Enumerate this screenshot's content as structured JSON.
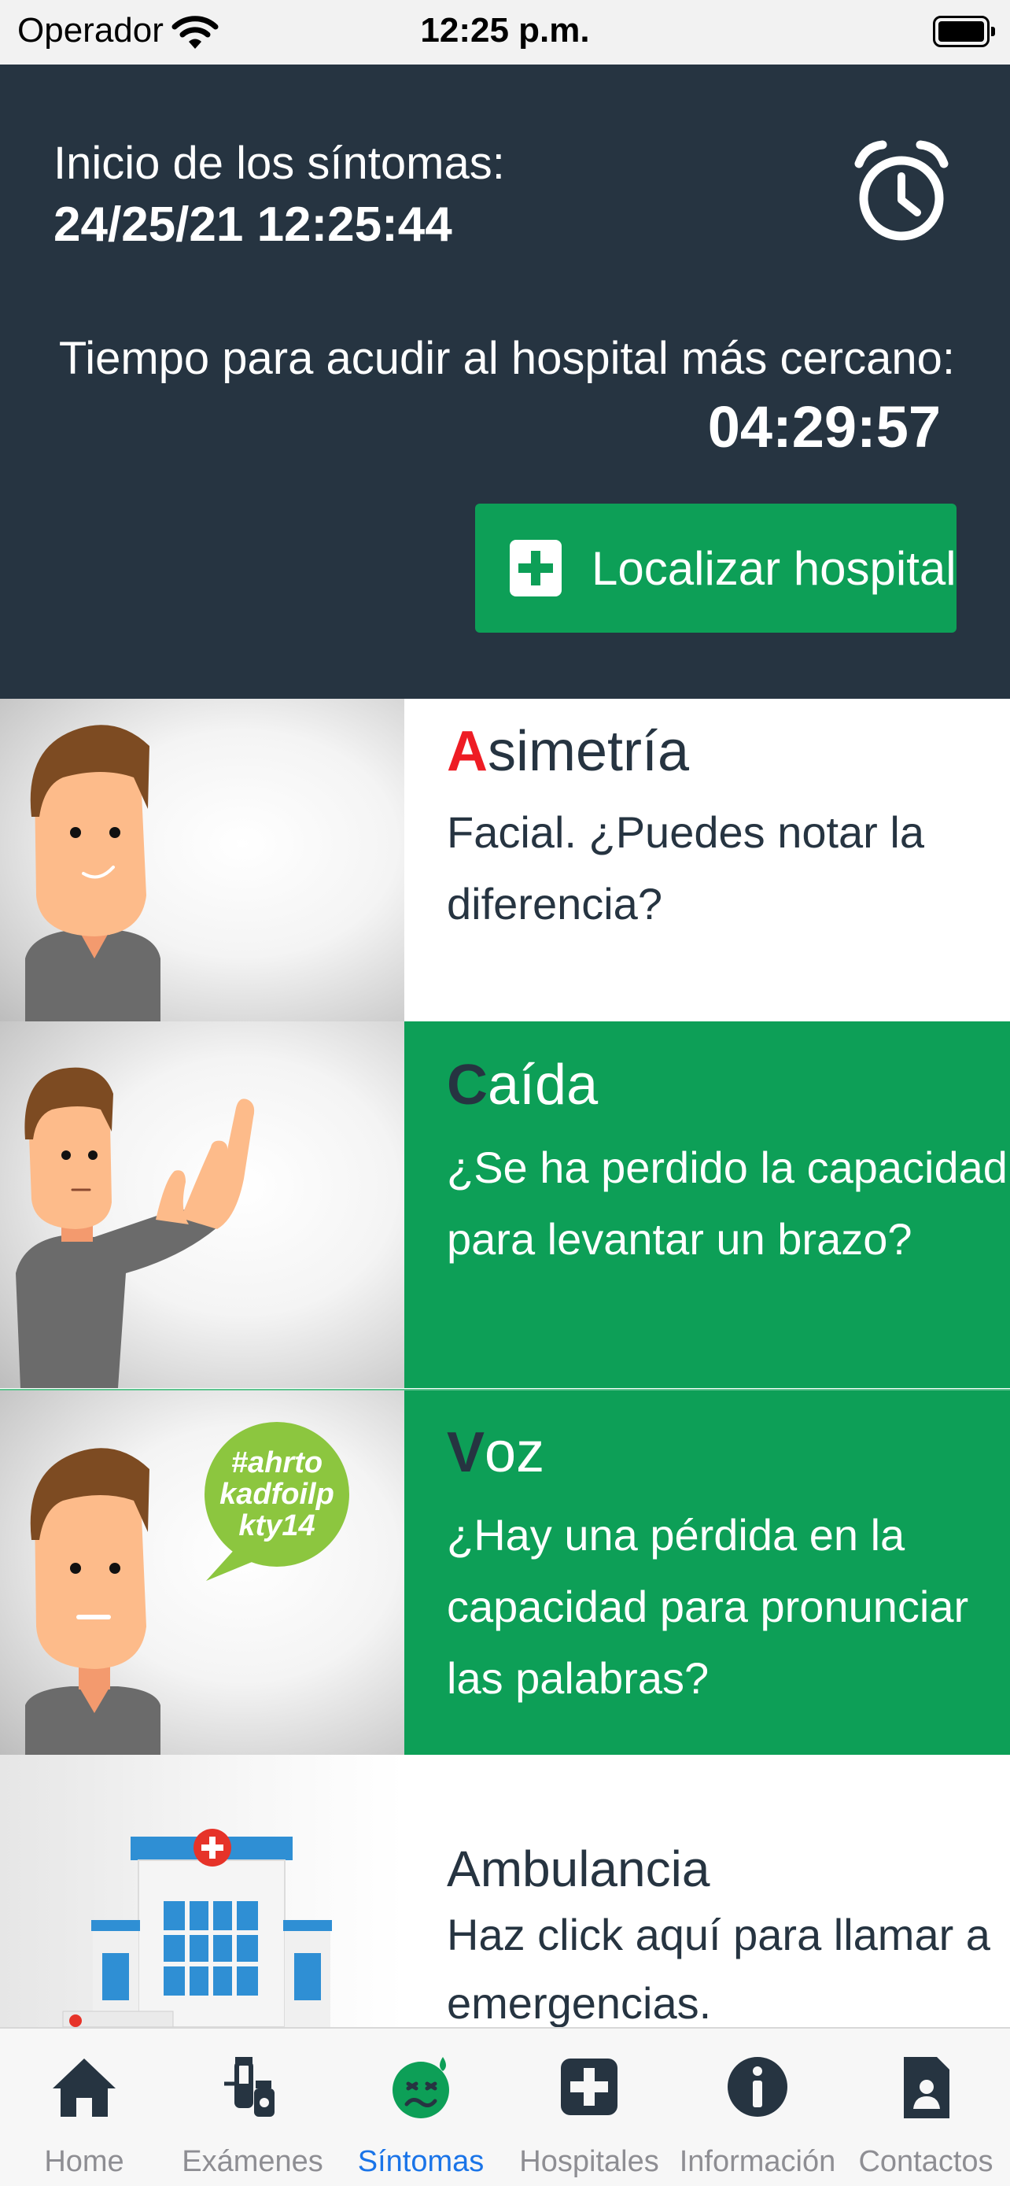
{
  "status_bar": {
    "carrier": "Operador",
    "time": "12:25 p.m."
  },
  "header": {
    "onset_label": "Inicio de los síntomas:",
    "onset_value": "24/25/21 12:25:44",
    "time_label": "Tiempo para acudir al hospital más cercano:",
    "time_value": "04:29:57",
    "locate_button": "Localizar hospital"
  },
  "symptoms": [
    {
      "title_first": "A",
      "title_rest": "simetría",
      "description": "Facial. ¿Puedes notar la diferencia?",
      "first_color": "#ee1c24"
    },
    {
      "title_first": "C",
      "title_rest": "aída",
      "description": "¿Se ha perdido la capacidad para levantar un brazo?",
      "first_color": "#263441"
    },
    {
      "title_first": "V",
      "title_rest": "oz",
      "description": "¿Hay una pérdida en la capacidad para pronunciar las palabras?",
      "first_color": "#263441",
      "bubble_text": [
        "#ahrto",
        "kadfoilp",
        "kty14"
      ]
    },
    {
      "title": "Ambulancia",
      "description": "Haz click aquí para llamar a emergencias."
    }
  ],
  "tabs": [
    {
      "label": "Home",
      "icon": "home-icon"
    },
    {
      "label": "Exámenes",
      "icon": "vials-icon"
    },
    {
      "label": "Síntomas",
      "icon": "sick-face-icon",
      "active": true
    },
    {
      "label": "Hospitales",
      "icon": "hospital-plus-icon"
    },
    {
      "label": "Información",
      "icon": "info-icon"
    },
    {
      "label": "Contactos",
      "icon": "contact-card-icon"
    }
  ],
  "colors": {
    "header_bg": "#263441",
    "accent_green": "#0d9f57",
    "active_tab": "#1a74e8",
    "inactive_tab": "#8e8e93",
    "asymmetry_letter": "#ee1c24"
  }
}
